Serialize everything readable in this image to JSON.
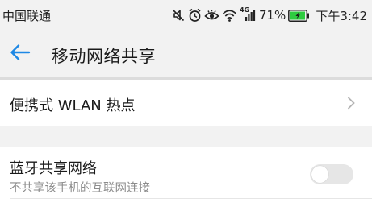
{
  "status_bar": {
    "carrier": "中国联通",
    "battery_percent": "71%",
    "battery_level": 0.71,
    "time": "下午3:42",
    "network_type": "4G",
    "icons": [
      "mute-icon",
      "alarm-icon",
      "eye-comfort-icon",
      "wifi-icon",
      "signal-icon",
      "battery-charging-icon"
    ]
  },
  "toolbar": {
    "title": "移动网络共享",
    "back_icon": "back-arrow-icon"
  },
  "settings": {
    "hotspot": {
      "label": "便携式 WLAN 热点",
      "icon": "chevron-right-icon"
    },
    "bluetooth_tethering": {
      "label": "蓝牙共享网络",
      "description": "不共享该手机的互联网连接",
      "enabled": false
    }
  },
  "colors": {
    "accent": "#1e88e5",
    "battery_fill": "#2ecc40",
    "background_gray": "#f2f2f2",
    "secondary_text": "#8c8c8c",
    "toggle_off": "#e6e6e6"
  }
}
